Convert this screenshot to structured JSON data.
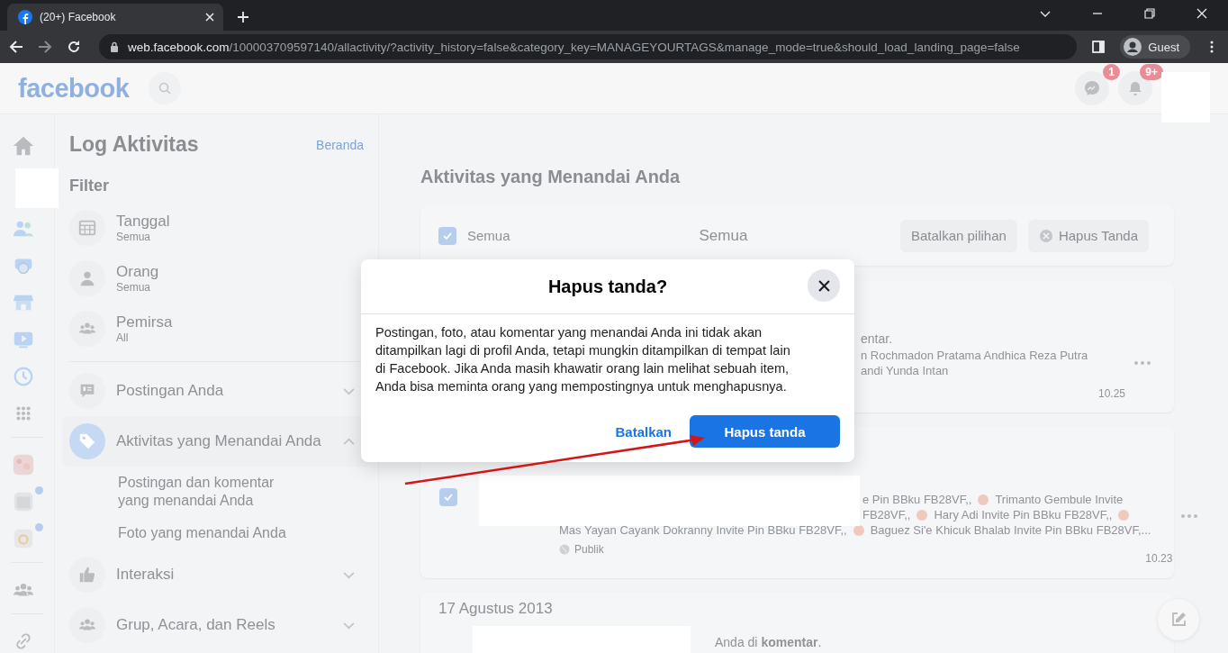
{
  "browser": {
    "tab_title": "(20+) Facebook",
    "url_host": "web.facebook.com",
    "url_path": "/100003709597140/allactivity/?activity_history=false&category_key=MANAGEYOURTAGS&manage_mode=true&should_load_landing_page=false",
    "profile": "Guest"
  },
  "header": {
    "logo": "facebook",
    "messenger_badge": "1",
    "notifications_badge": "9+"
  },
  "rail": [
    {
      "kind": "home",
      "dot": false
    },
    {
      "kind": "friends",
      "dot": false
    },
    {
      "kind": "memories",
      "dot": false
    },
    {
      "kind": "store",
      "dot": false
    },
    {
      "kind": "video",
      "dot": false
    },
    {
      "kind": "clock",
      "dot": false
    },
    {
      "kind": "grid",
      "dot": false
    },
    {
      "kind": "picture",
      "dot": false
    },
    {
      "kind": "page",
      "dot": true
    },
    {
      "kind": "app",
      "dot": true
    },
    {
      "kind": "groups",
      "dot": false
    },
    {
      "kind": "link",
      "dot": false
    }
  ],
  "sidebar": {
    "title": "Log Aktivitas",
    "home_link": "Beranda",
    "filter_heading": "Filter",
    "filters": [
      {
        "kind": "calendar",
        "label": "Tanggal",
        "value": "Semua"
      },
      {
        "kind": "person",
        "label": "Orang",
        "value": "Semua"
      },
      {
        "kind": "people",
        "label": "Pemirsa",
        "value": "All"
      }
    ],
    "categories": [
      {
        "kind": "posts",
        "label": "Postingan Anda",
        "selected": false,
        "expanded": false
      },
      {
        "kind": "tag",
        "label": "Aktivitas yang Menandai Anda",
        "selected": true,
        "expanded": true,
        "children": [
          {
            "label": "Postingan dan komentar yang menandai Anda"
          },
          {
            "label": "Foto yang menandai Anda"
          }
        ]
      },
      {
        "kind": "like",
        "label": "Interaksi",
        "selected": false,
        "expanded": false
      },
      {
        "kind": "people",
        "label": "Grup, Acara, dan Reels",
        "selected": false,
        "expanded": false
      }
    ]
  },
  "main": {
    "title": "Aktivitas yang Menandai Anda",
    "toolbar": {
      "select_all": {
        "label": "Semua",
        "checked": true
      },
      "filter_label": "Semua",
      "buttons": [
        "Batalkan pilihan",
        "Hapus Tanda"
      ]
    },
    "entries": [
      {
        "lines": [
          [
            {
              "kind": "text",
              "text": "entar."
            }
          ],
          [
            {
              "kind": "text",
              "text": "n Rochmadon Pratama Andhica Reza Putra"
            }
          ],
          [
            {
              "kind": "text",
              "text": "andi Yunda Intan"
            }
          ]
        ],
        "time": "10.25"
      },
      {
        "checked": true,
        "lines": [
          [
            {
              "kind": "text",
              "text": "e Pin BBku FB28VF,,"
            },
            {
              "kind": "emoji"
            },
            {
              "kind": "text",
              "text": "Trimanto Gembule Invite"
            }
          ],
          [
            {
              "kind": "text",
              "text": "FB28VF,,"
            },
            {
              "kind": "emoji"
            },
            {
              "kind": "text",
              "text": "Hary Adi Invite Pin BBku FB28VF,,"
            },
            {
              "kind": "emoji"
            }
          ],
          [
            {
              "kind": "text",
              "text": "Mas Yayan Cayank Dokranny Invite Pin BBku FB28VF,,"
            },
            {
              "kind": "emoji"
            },
            {
              "kind": "text",
              "text": "Baguez Si'e Khicuk Bhalab Invite Pin BBku FB28VF,..."
            }
          ]
        ],
        "audience": "Publik",
        "time": "10.23"
      }
    ],
    "date_heading": "17 Agustus 2013",
    "last_line": "Anda di **komentar**."
  },
  "dialog": {
    "title": "Hapus tanda?",
    "body": "Postingan, foto, atau komentar yang menandai Anda ini tidak akan ditampilkan lagi di profil Anda, tetapi mungkin ditampilkan di tempat lain di Facebook. Jika Anda masih khawatir orang lain melihat sebuah item, Anda bisa meminta orang yang mempostingnya untuk menghapusnya.",
    "cancel": "Batalkan",
    "confirm": "Hapus tanda"
  }
}
